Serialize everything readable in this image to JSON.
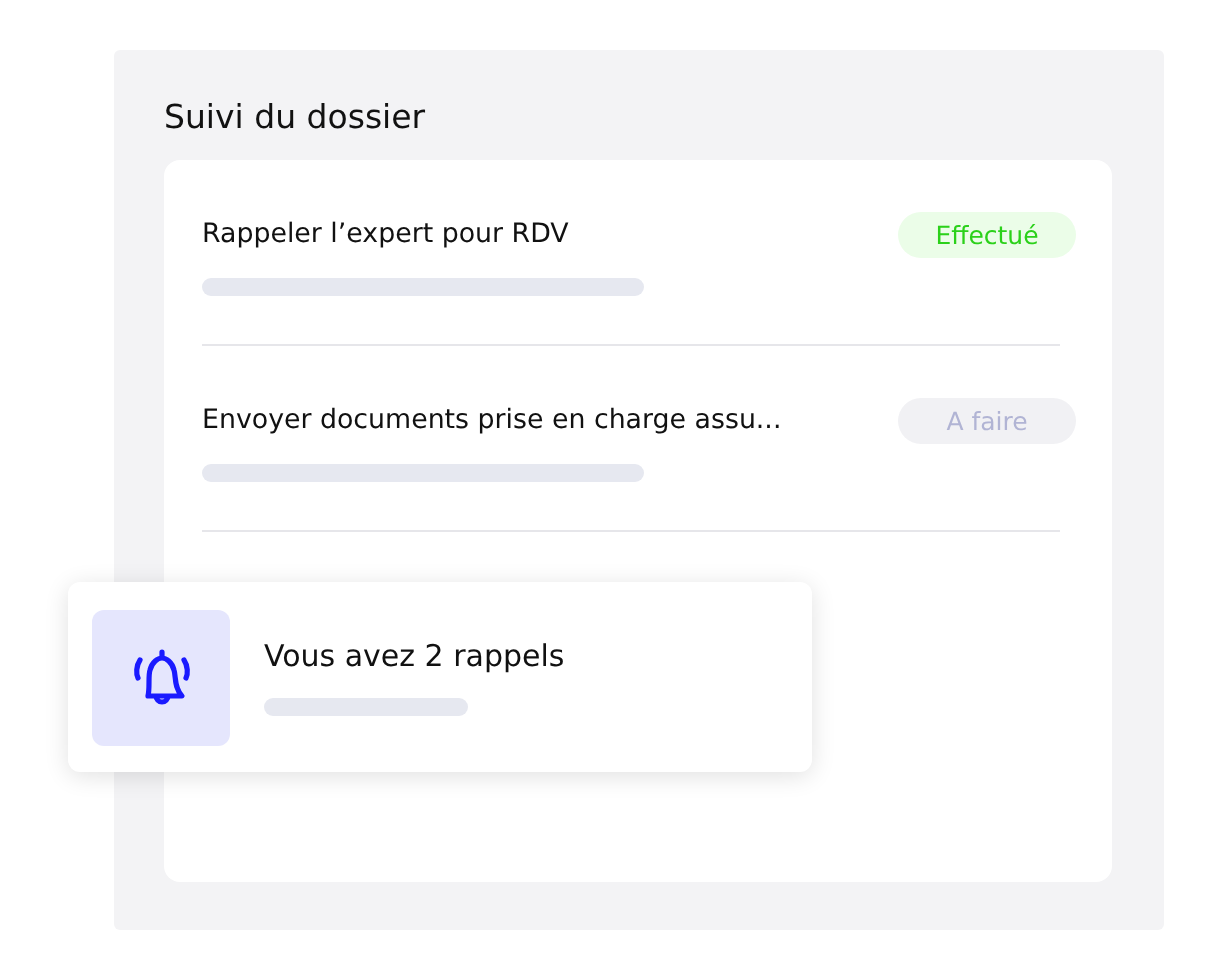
{
  "panel": {
    "title": "Suivi du dossier"
  },
  "tasks": [
    {
      "label": "Rappeler l’expert pour RDV",
      "status": {
        "kind": "done",
        "label": "Effectué"
      }
    },
    {
      "label": "Envoyer documents prise en charge assu...",
      "status": {
        "kind": "todo",
        "label": "A faire"
      }
    }
  ],
  "notification": {
    "text": "Vous avez 2 rappels"
  }
}
